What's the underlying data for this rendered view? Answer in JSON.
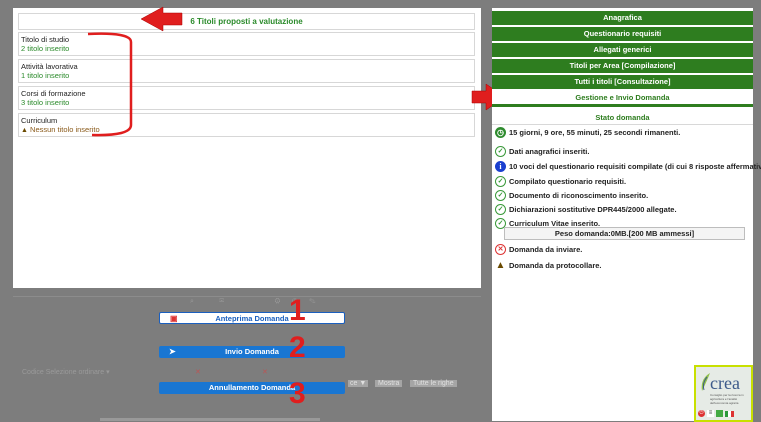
{
  "titles_panel": {
    "header": "6 Titoli proposti a valutazione",
    "categories": [
      {
        "name": "Titolo di studio",
        "count": "2 titolo inserito"
      },
      {
        "name": "Attività lavorativa",
        "count": "1 titolo inserito"
      },
      {
        "name": "Corsi di formazione",
        "count": "3 titolo inserito"
      },
      {
        "name": "Curriculum",
        "count": "Nessun titolo inserito"
      }
    ]
  },
  "nav": {
    "items": [
      "Anagrafica",
      "Questionario requisiti",
      "Allegati generici",
      "Titoli per Area [Compilazione]",
      "Tutti i titoli [Consultazione]",
      "Gestione e Invio Domanda"
    ]
  },
  "status": {
    "header": "Stato domanda",
    "time_remaining": "15 giorni, 9 ore, 55 minuti, 25 secondi rimanenti.",
    "lines": [
      "Dati anagrafici inseriti.",
      "10 voci del questionario requisiti compilate (di cui 8 risposte affermative).",
      "Compilato questionario requisiti.",
      "Documento di riconoscimento inserito.",
      "Dichiarazioni sostitutive DPR445/2000 allegate.",
      "Curriculum Vitae inserito."
    ],
    "peso": "Peso domanda:0MB.[200 MB ammessi]",
    "pending": [
      "Domanda da inviare.",
      "Domanda da protocollare."
    ]
  },
  "background": {
    "codice_label": "Codice Selezione",
    "codice_value": "ordinare",
    "filter_label": "Mostra",
    "rows_label": "Tutte le righe"
  },
  "actions": {
    "preview": "Anteprima Domanda",
    "send": "Invio Domanda",
    "cancel": "Annullamento Domanda"
  },
  "annotations": {
    "one": "1",
    "two": "2",
    "three": "3"
  },
  "logo": {
    "text": "crea",
    "sub": "Consiglio per la ricerca in agricoltura e l'analisi dell'economia agraria"
  },
  "colors": {
    "green": "#2e7d1f",
    "blue": "#1976d2",
    "red_annotation": "#e01e1e"
  }
}
